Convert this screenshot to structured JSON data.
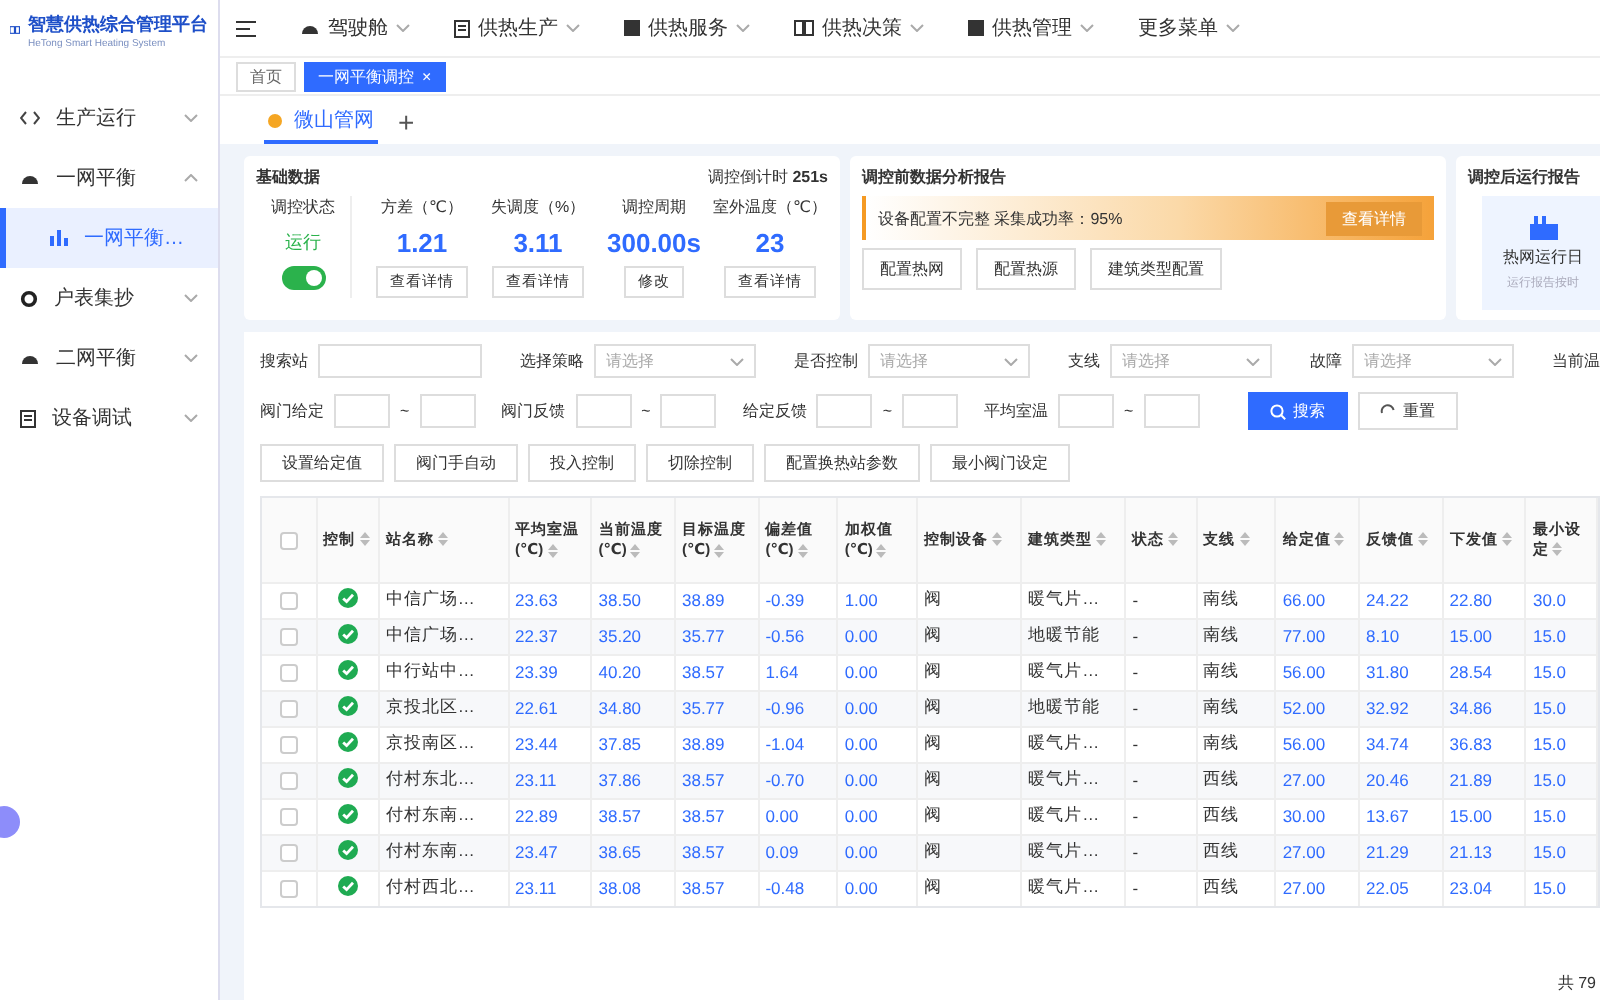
{
  "logo": {
    "title": "智慧供热综合管理平台",
    "subtitle": "HeTong Smart Heating System"
  },
  "sidebar": {
    "items": [
      {
        "label": "生产运行",
        "expanded": false
      },
      {
        "label": "一网平衡",
        "expanded": true,
        "children": [
          {
            "label": "一网平衡…",
            "selected": true
          }
        ]
      },
      {
        "label": "户表集抄",
        "expanded": false
      },
      {
        "label": "二网平衡",
        "expanded": false
      },
      {
        "label": "设备调试",
        "expanded": false
      }
    ]
  },
  "top_menu": [
    {
      "label": "驾驶舱"
    },
    {
      "label": "供热生产"
    },
    {
      "label": "供热服务"
    },
    {
      "label": "供热决策"
    },
    {
      "label": "供热管理"
    },
    {
      "label": "更多菜单"
    }
  ],
  "page_tabs": [
    {
      "label": "首页",
      "selected": false
    },
    {
      "label": "一网平衡调控",
      "selected": true
    }
  ],
  "close_mark": "×",
  "network_tabs": [
    {
      "label": "微山管网",
      "selected": true
    }
  ],
  "add_mark": "+",
  "basic": {
    "title": "基础数据",
    "countdown_label": "调控倒计时",
    "countdown": "251s",
    "status_label": "调控状态",
    "status": "运行",
    "switch_on": true,
    "stats": [
      {
        "label": "方差（℃）",
        "value": "1.21",
        "button": "查看详情"
      },
      {
        "label": "失调度（%）",
        "value": "3.11",
        "button": "查看详情"
      },
      {
        "label": "调控周期",
        "value": "300.00s",
        "button": "修改"
      },
      {
        "label": "室外温度（℃）",
        "value": "23",
        "button": "查看详情"
      }
    ]
  },
  "analysis": {
    "title": "调控前数据分析报告",
    "alert": "设备配置不完整 采集成功率：95%",
    "alert_button": "查看详情",
    "buttons": [
      "配置热网",
      "配置热源",
      "建筑类型配置"
    ]
  },
  "after_report": {
    "title": "调控后运行报告",
    "label": "热网运行日",
    "note": "运行报告按时"
  },
  "filters": {
    "row1": [
      {
        "label": "搜索站",
        "kind": "input"
      },
      {
        "label": "选择策略",
        "kind": "select",
        "placeholder": "请选择"
      },
      {
        "label": "是否控制",
        "kind": "select",
        "placeholder": "请选择"
      },
      {
        "label": "支线",
        "kind": "select",
        "placeholder": "请选择"
      },
      {
        "label": "故障",
        "kind": "select",
        "placeholder": "请选择"
      },
      {
        "label": "当前温",
        "kind": "cut"
      }
    ],
    "row2": [
      "阀门给定",
      "阀门反馈",
      "给定反馈",
      "平均室温"
    ],
    "range_mark": "~",
    "search": "搜索",
    "reset": "重置"
  },
  "actions": [
    "设置给定值",
    "阀门手自动",
    "投入控制",
    "切除控制",
    "配置换热站参数",
    "最小阀门设定"
  ],
  "table": {
    "select_all_checked": false,
    "control_header": "控制",
    "columns": [
      "站名称",
      "平均室温(℃)",
      "当前温度(℃)",
      "目标温度(℃)",
      "偏差值(℃)",
      "加权值(℃)",
      "控制设备",
      "建筑类型",
      "状态",
      "支线",
      "给定值",
      "反馈值",
      "下发值",
      "最小设定"
    ],
    "rows": [
      {
        "checked": false,
        "control_on": true,
        "cells": [
          "中信广场…",
          "23.63",
          "38.50",
          "38.89",
          "-0.39",
          "1.00",
          "阀",
          "暖气片…",
          "-",
          "南线",
          "66.00",
          "24.22",
          "22.80",
          "30.0"
        ]
      },
      {
        "checked": false,
        "control_on": true,
        "cells": [
          "中信广场…",
          "22.37",
          "35.20",
          "35.77",
          "-0.56",
          "0.00",
          "阀",
          "地暖节能",
          "-",
          "南线",
          "77.00",
          "8.10",
          "15.00",
          "15.0"
        ]
      },
      {
        "checked": false,
        "control_on": true,
        "cells": [
          "中行站中…",
          "23.39",
          "40.20",
          "38.57",
          "1.64",
          "0.00",
          "阀",
          "暖气片…",
          "-",
          "南线",
          "56.00",
          "31.80",
          "28.54",
          "15.0"
        ]
      },
      {
        "checked": false,
        "control_on": true,
        "cells": [
          "京投北区…",
          "22.61",
          "34.80",
          "35.77",
          "-0.96",
          "0.00",
          "阀",
          "地暖节能",
          "-",
          "南线",
          "52.00",
          "32.92",
          "34.86",
          "15.0"
        ]
      },
      {
        "checked": false,
        "control_on": true,
        "cells": [
          "京投南区…",
          "23.44",
          "37.85",
          "38.89",
          "-1.04",
          "0.00",
          "阀",
          "暖气片…",
          "-",
          "南线",
          "56.00",
          "34.74",
          "36.83",
          "15.0"
        ]
      },
      {
        "checked": false,
        "control_on": true,
        "cells": [
          "付村东北…",
          "23.11",
          "37.86",
          "38.57",
          "-0.70",
          "0.00",
          "阀",
          "暖气片…",
          "-",
          "西线",
          "27.00",
          "20.46",
          "21.89",
          "15.0"
        ]
      },
      {
        "checked": false,
        "control_on": true,
        "cells": [
          "付村东南…",
          "22.89",
          "38.57",
          "38.57",
          "0.00",
          "0.00",
          "阀",
          "暖气片…",
          "-",
          "西线",
          "30.00",
          "13.67",
          "15.00",
          "15.0"
        ]
      },
      {
        "checked": false,
        "control_on": true,
        "cells": [
          "付村东南…",
          "23.47",
          "38.65",
          "38.57",
          "0.09",
          "0.00",
          "阀",
          "暖气片…",
          "-",
          "西线",
          "27.00",
          "21.29",
          "21.13",
          "15.0"
        ]
      },
      {
        "checked": false,
        "control_on": true,
        "cells": [
          "付村西北…",
          "23.11",
          "38.08",
          "38.57",
          "-0.48",
          "0.00",
          "阀",
          "暖气片…",
          "-",
          "西线",
          "27.00",
          "22.05",
          "23.04",
          "15.0"
        ]
      }
    ]
  },
  "pagination": {
    "total": "共 79"
  }
}
